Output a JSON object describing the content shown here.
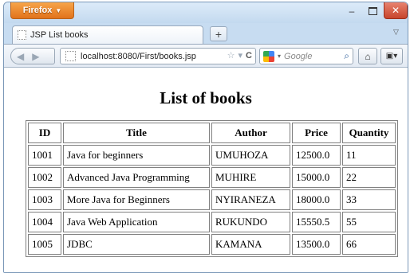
{
  "browser": {
    "menu_label": "Firefox",
    "tab_title": "JSP List books",
    "new_tab_symbol": "+",
    "url": "localhost:8080/First/books.jsp",
    "search_placeholder": "Google"
  },
  "page": {
    "heading": "List of books",
    "columns": [
      "ID",
      "Title",
      "Author",
      "Price",
      "Quantity"
    ],
    "rows": [
      [
        "1001",
        "Java for beginners",
        "UMUHOZA",
        "12500.0",
        "11"
      ],
      [
        "1002",
        "Advanced Java Programming",
        "MUHIRE",
        "15000.0",
        "22"
      ],
      [
        "1003",
        "More Java for Beginners",
        "NYIRANEZA",
        "18000.0",
        "33"
      ],
      [
        "1004",
        "Java Web Application",
        "RUKUNDO",
        "15550.5",
        "55"
      ],
      [
        "1005",
        "JDBC",
        "KAMANA",
        "13500.0",
        "66"
      ]
    ]
  },
  "icons": {
    "back": "back-arrow-icon",
    "forward": "forward-arrow-icon",
    "star": "bookmark-star-icon",
    "reload": "reload-icon",
    "search": "magnifier-icon",
    "home": "home-icon",
    "bookmarks": "bookmarks-menu-icon"
  },
  "colors": {
    "firefox_button": "#e1731b",
    "close_button": "#c7452d",
    "chrome": "#c7dcf1"
  }
}
